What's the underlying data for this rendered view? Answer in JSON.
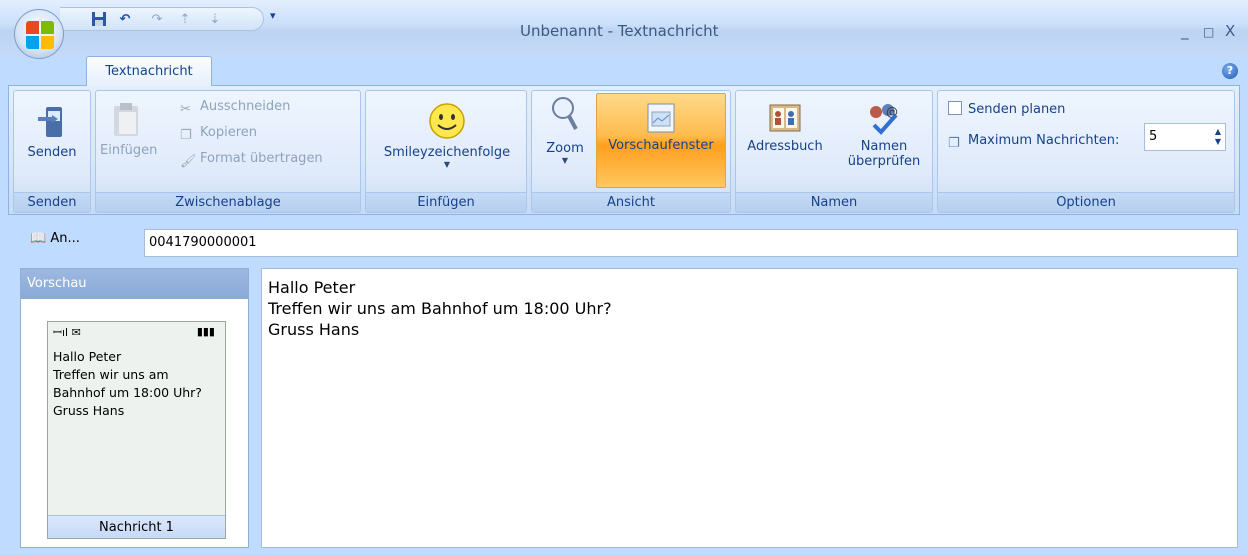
{
  "window": {
    "title": "Unbenannt - Textnachricht",
    "minimize": "_",
    "maximize": "□",
    "close": "X"
  },
  "tabs": [
    {
      "label": "Textnachricht"
    }
  ],
  "ribbon": {
    "groups": {
      "senden": {
        "label": "Senden",
        "send_label": "Senden"
      },
      "clipboard": {
        "label": "Zwischenablage",
        "paste_label": "Einfügen",
        "cut_label": "Ausschneiden",
        "copy_label": "Kopieren",
        "format_label": "Format übertragen"
      },
      "insert": {
        "label": "Einfügen",
        "smiley_label": "Smileyzeichenfolge"
      },
      "view": {
        "label": "Ansicht",
        "zoom_label": "Zoom",
        "preview_label": "Vorschaufenster"
      },
      "names": {
        "label": "Namen",
        "addressbook_label": "Adressbuch",
        "check_names_line1": "Namen",
        "check_names_line2": "überprüfen"
      },
      "options": {
        "label": "Optionen",
        "schedule_label": "Senden planen",
        "max_messages_label": "Maximum Nachrichten:",
        "max_messages_value": "5"
      }
    }
  },
  "to": {
    "button_label": "An...",
    "value": "0041790000001"
  },
  "preview": {
    "header": "Vorschau",
    "message_text": "Hallo Peter\nTreffen wir uns am\nBahnhof um 18:00 Uhr?\nGruss Hans",
    "footer": "Nachricht 1"
  },
  "message": {
    "body": "Hallo Peter\nTreffen wir uns am Bahnhof um 18:00 Uhr?\nGruss Hans"
  },
  "colors": {
    "ribbon_bg": "#d7e6f9",
    "accent_orange": "#ffbb4d",
    "text_blue": "#15428b"
  }
}
